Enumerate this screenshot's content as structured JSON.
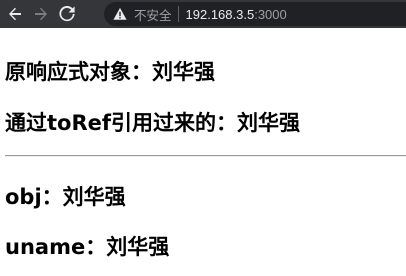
{
  "browser": {
    "back_icon": "arrow-left-icon",
    "forward_icon": "arrow-right-icon",
    "reload_icon": "reload-icon",
    "security_icon": "warning-triangle-icon",
    "security_label": "不安全",
    "url_host": "192.168.3.5",
    "url_port": ":3000"
  },
  "page": {
    "line1": "原响应式对象：刘华强",
    "line2": "通过toRef引用过来的：刘华强",
    "line3": "obj：刘华强",
    "line4": "uname：刘华强"
  },
  "colors": {
    "toolbar_bg": "#35363a",
    "omnibox_bg": "#202124",
    "text": "#000000"
  }
}
